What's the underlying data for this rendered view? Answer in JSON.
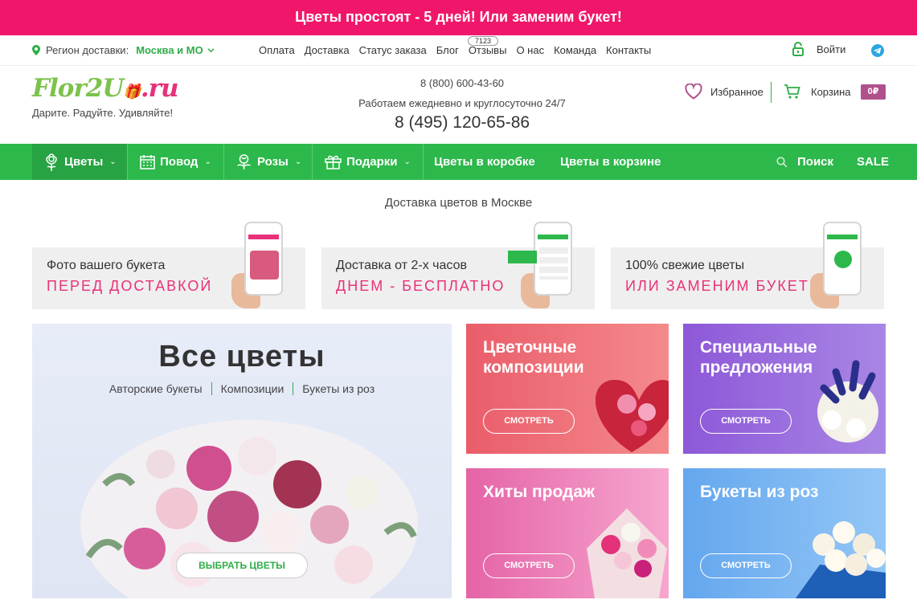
{
  "promo_banner": "Цветы простоят - 5 дней! Или заменим букет!",
  "topnav": {
    "region_label": "Регион доставки:",
    "region_city": "Москва и МО",
    "links": [
      "Оплата",
      "Доставка",
      "Статус заказа",
      "Блог",
      "Отзывы",
      "О нас",
      "Команда",
      "Контакты"
    ],
    "reviews_count": "7123",
    "login": "Войти"
  },
  "header": {
    "logo_green": "Flor2U",
    "logo_suffix": ".ru",
    "tagline": "Дарите. Радуйте. Удивляйте!",
    "phone_toll_free": "8 (800) 600-43-60",
    "hours": "Работаем ежедневно и круглосуточно 24/7",
    "phone_main": "8 (495) 120-65-86",
    "favorites": "Избранное",
    "cart": "Корзина",
    "cart_total": "0₽"
  },
  "mainnav": {
    "items": [
      "Цветы",
      "Повод",
      "Розы",
      "Подарки",
      "Цветы в коробке",
      "Цветы в корзине"
    ],
    "search": "Поиск",
    "sale": "SALE"
  },
  "subtitle": "Доставка цветов в Москве",
  "promo_cards": [
    {
      "line1": "Фото вашего букета",
      "line2": "ПЕРЕД ДОСТАВКОЙ"
    },
    {
      "line1": "Доставка от 2-х часов",
      "line2": "ДНЕМ - БЕСПЛАТНО"
    },
    {
      "line1": "100% свежие цветы",
      "line2": "ИЛИ ЗАМЕНИМ БУКЕТ"
    }
  ],
  "all_flowers": {
    "title": "Все цветы",
    "categories": [
      "Авторские букеты",
      "Композиции",
      "Букеты из роз"
    ],
    "button": "ВЫБРАТЬ ЦВЕТЫ"
  },
  "tiles": [
    {
      "title": "Цветочные композиции",
      "button": "СМОТРЕТЬ"
    },
    {
      "title": "Специальные предложения",
      "button": "СМОТРЕТЬ"
    },
    {
      "title": "Хиты продаж",
      "button": "СМОТРЕТЬ"
    },
    {
      "title": "Букеты из роз",
      "button": "СМОТРЕТЬ"
    }
  ],
  "colors": {
    "brand_green": "#2db84b",
    "promo_pink": "#f0176a",
    "accent_pink": "#e8317a"
  }
}
